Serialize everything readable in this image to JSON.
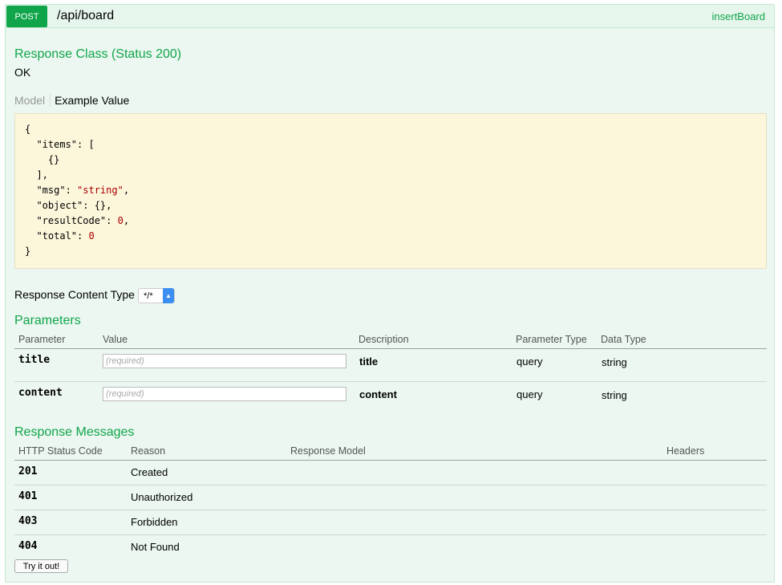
{
  "operation": {
    "method": "POST",
    "path": "/api/board",
    "nickname": "insertBoard"
  },
  "response_class": {
    "heading": "Response Class (Status 200)",
    "status_text": "OK",
    "tab_model": "Model",
    "tab_example": "Example Value",
    "example_lines": {
      "l1": "{",
      "l2_key": "  \"items\": [",
      "l3": "    {}",
      "l4": "  ],",
      "l5_key": "  \"msg\": ",
      "l5_val": "\"string\"",
      "l5_end": ",",
      "l6": "  \"object\": {},",
      "l7_key": "  \"resultCode\": ",
      "l7_val": "0",
      "l7_end": ",",
      "l8_key": "  \"total\": ",
      "l8_val": "0",
      "l9": "}"
    }
  },
  "content_type": {
    "label": "Response Content Type",
    "selected": "*/*"
  },
  "parameters": {
    "heading": "Parameters",
    "columns": [
      "Parameter",
      "Value",
      "Description",
      "Parameter Type",
      "Data Type"
    ],
    "rows": [
      {
        "name": "title",
        "placeholder": "(required)",
        "description": "title",
        "param_type": "query",
        "data_type": "string"
      },
      {
        "name": "content",
        "placeholder": "(required)",
        "description": "content",
        "param_type": "query",
        "data_type": "string"
      }
    ]
  },
  "response_messages": {
    "heading": "Response Messages",
    "columns": [
      "HTTP Status Code",
      "Reason",
      "Response Model",
      "Headers"
    ],
    "rows": [
      {
        "code": "201",
        "reason": "Created"
      },
      {
        "code": "401",
        "reason": "Unauthorized"
      },
      {
        "code": "403",
        "reason": "Forbidden"
      },
      {
        "code": "404",
        "reason": "Not Found"
      }
    ]
  },
  "try_button": "Try it out!",
  "colors": {
    "method_bg": "#10a54a",
    "panel_bg": "#ebf7f0",
    "panel_border": "#c3e8d1",
    "example_bg": "#fcf6db",
    "heading": "#10a54a"
  }
}
